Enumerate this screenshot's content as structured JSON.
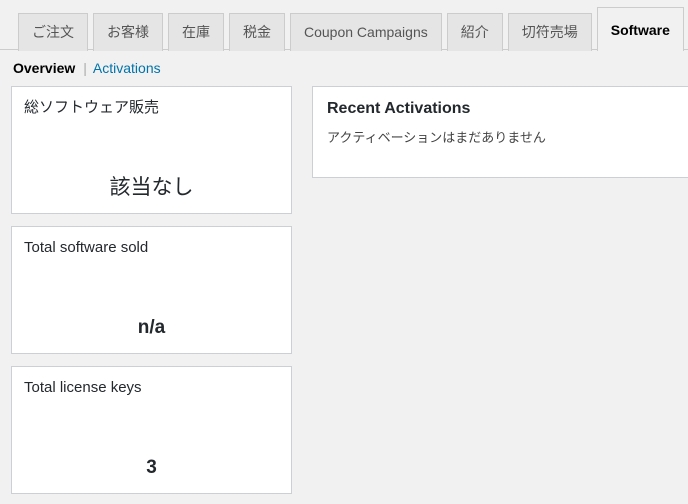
{
  "tabs": [
    {
      "label": "ご注文",
      "active": false
    },
    {
      "label": "お客様",
      "active": false
    },
    {
      "label": "在庫",
      "active": false
    },
    {
      "label": "税金",
      "active": false
    },
    {
      "label": "Coupon Campaigns",
      "active": false
    },
    {
      "label": "紹介",
      "active": false
    },
    {
      "label": "切符売場",
      "active": false
    },
    {
      "label": "Software",
      "active": true
    }
  ],
  "subnav": {
    "current": "Overview",
    "separator": "|",
    "link": "Activations"
  },
  "cards": [
    {
      "title": "総ソフトウェア販売",
      "value": "該当なし",
      "bold": false
    },
    {
      "title": "Total software sold",
      "value": "n/a",
      "bold": true
    },
    {
      "title": "Total license keys",
      "value": "3",
      "bold": true
    }
  ],
  "panel": {
    "title": "Recent Activations",
    "empty_message": "アクティベーションはまだありません"
  },
  "colors": {
    "background": "#f1f1f1",
    "tab_inactive_bg": "#e5e5e5",
    "tab_border": "#cccccc",
    "card_border": "#ccd0d4",
    "link": "#0073aa",
    "text": "#23282d"
  }
}
